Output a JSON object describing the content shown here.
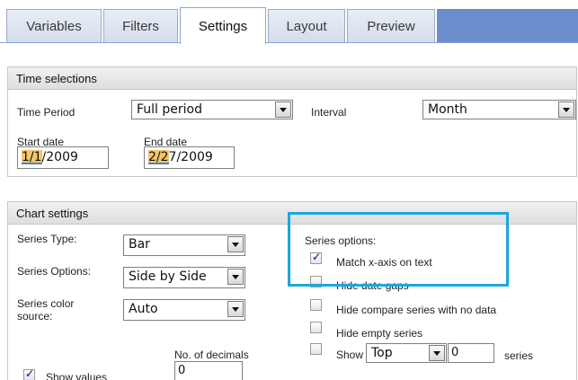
{
  "tabs": [
    {
      "label": "Variables",
      "active": false
    },
    {
      "label": "Filters",
      "active": false
    },
    {
      "label": "Settings",
      "active": true
    },
    {
      "label": "Layout",
      "active": false
    },
    {
      "label": "Preview",
      "active": false
    }
  ],
  "time_selections": {
    "title": "Time selections",
    "time_period_label": "Time Period",
    "time_period_value": "Full period",
    "interval_label": "Interval",
    "interval_value": "Month",
    "start_date_label": "Start date",
    "start_date_hl": "1/1",
    "start_date_rest": "/2009",
    "end_date_label": "End date",
    "end_date_hl": "2/2",
    "end_date_rest": "7/2009"
  },
  "chart_settings": {
    "title": "Chart settings",
    "series_type_label": "Series Type:",
    "series_type_value": "Bar",
    "series_options_label": "Series Options:",
    "series_options_value": "Side by Side",
    "series_color_label_1": "Series color",
    "series_color_label_2": "source:",
    "series_color_value": "Auto",
    "decimals_label": "No. of decimals",
    "decimals_value": "0",
    "cut_checkbox_label": "Show values",
    "series_options_heading": "Series options:",
    "match_x_axis_label": "Match x-axis on text",
    "match_x_axis_checked": true,
    "hide_date_gaps_label": "Hide date gaps",
    "hide_date_gaps_checked": false,
    "hide_compare_label": "Hide compare series with no data",
    "hide_compare_checked": false,
    "hide_empty_label": "Hide empty series",
    "hide_empty_checked": false,
    "show_label": "Show",
    "show_checked": false,
    "show_mode_value": "Top",
    "show_count_value": "0",
    "series_suffix": "series"
  },
  "colors": {
    "accent": "#6b8dcd",
    "highlight_box": "#1ea6dd"
  }
}
